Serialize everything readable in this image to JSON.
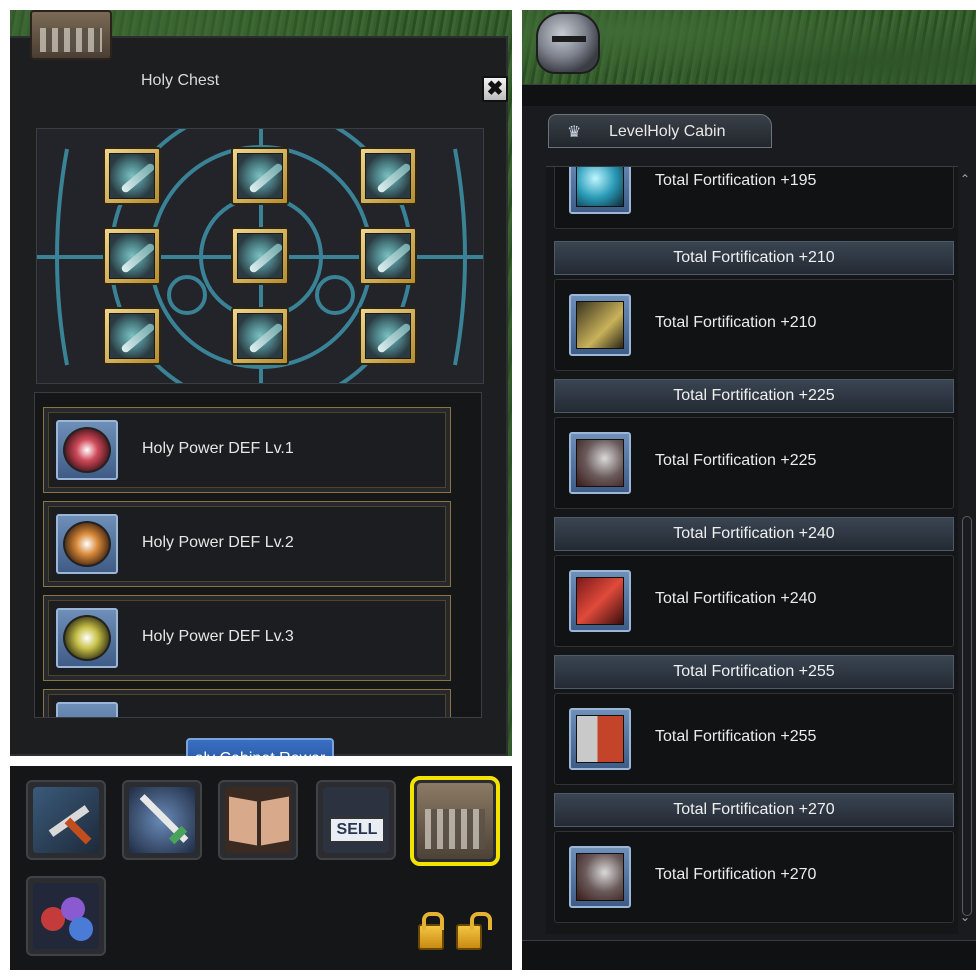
{
  "holy_chest": {
    "title": "Holy Chest",
    "close_label": "✖",
    "weapon_slots": [
      "claw-weapon",
      "fan-weapon",
      "staff-weapon",
      "spear-weapon",
      "wing-weapon",
      "axe-weapon",
      "knuckle-weapon",
      "wing-blade-weapon",
      "shield-weapon"
    ],
    "powers": [
      {
        "label": "Holy Power DEF Lv.1",
        "color": "#d04a5a"
      },
      {
        "label": "Holy Power DEF Lv.2",
        "color": "#d98a3a"
      },
      {
        "label": "Holy Power DEF Lv.3",
        "color": "#c8c24a"
      }
    ],
    "scroll_up": "△",
    "scroll_down": "▽",
    "reward_button": "oly Cabinet Rewar"
  },
  "toolbar": {
    "buttons": [
      "hammer-tool",
      "sword-tool",
      "book-tool",
      "sell-tool",
      "holy-chest-tool",
      "gems-tool"
    ],
    "sell_label": "SELL"
  },
  "cabin": {
    "tab_label": "LevelHoly Cabin",
    "crown_icon": "♛",
    "scroll_up": "⌃",
    "scroll_down": "⌄",
    "top_item": {
      "label": "Total Fortification +195",
      "icon": "cyan-blade-icon"
    },
    "sections": [
      {
        "header": "Total Fortification +210",
        "label": "Total Fortification +210",
        "icon": "dash-icon"
      },
      {
        "header": "Total Fortification +225",
        "label": "Total Fortification +225",
        "icon": "armor-icon"
      },
      {
        "header": "Total Fortification +240",
        "label": "Total Fortification +240",
        "icon": "red-slash-icon"
      },
      {
        "header": "Total Fortification +255",
        "label": "Total Fortification +255",
        "icon": "gauntlet-icon"
      },
      {
        "header": "Total Fortification +270",
        "label": "Total Fortification +270",
        "icon": "armor-icon"
      }
    ]
  }
}
